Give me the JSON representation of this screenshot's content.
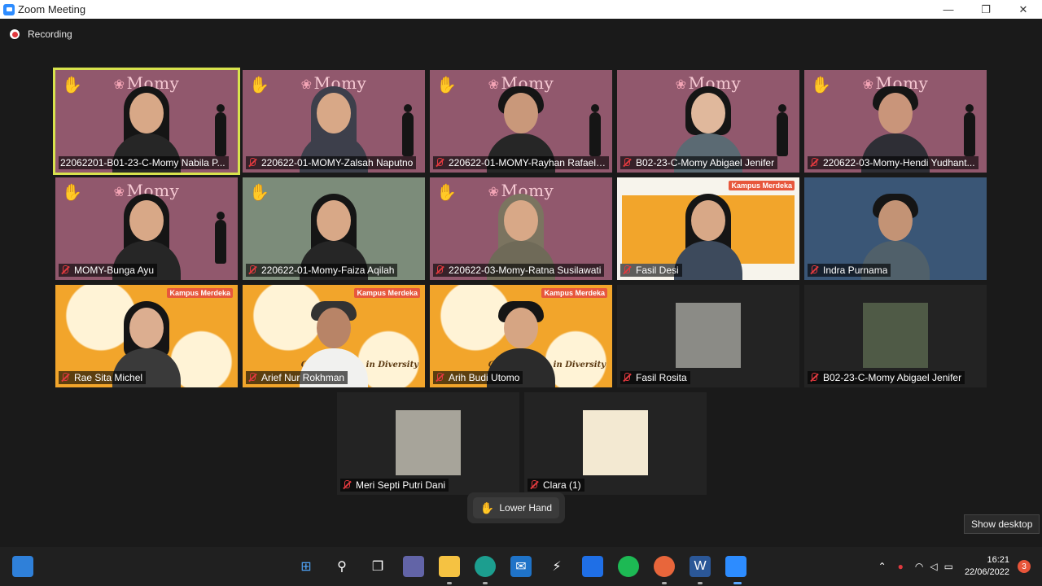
{
  "window": {
    "title": "Zoom Meeting",
    "minimize_glyph": "—",
    "restore_glyph": "❐",
    "close_glyph": "✕"
  },
  "recording": {
    "label": "Recording"
  },
  "participants": [
    {
      "name": "22062201-B01-23-C-Momy Nabila P...",
      "active": true,
      "background": "momy",
      "hand_raised": true,
      "muted": false
    },
    {
      "name": "220622-01-MOMY-Zalsah Naputno",
      "background": "momy",
      "hand_raised": true,
      "muted": true
    },
    {
      "name": "220622-01-MOMY-Rayhan Rafael ...",
      "background": "momy",
      "hand_raised": true,
      "muted": true
    },
    {
      "name": "B02-23-C-Momy Abigael Jenifer",
      "background": "momy",
      "hand_raised": false,
      "muted": true
    },
    {
      "name": "220622-03-Momy-Hendi Yudhant...",
      "background": "momy",
      "hand_raised": true,
      "muted": true
    },
    {
      "name": "MOMY-Bunga Ayu",
      "background": "momy",
      "hand_raised": true,
      "muted": true
    },
    {
      "name": "220622-01-Momy-Faiza Aqilah",
      "background": "plain",
      "hand_raised": true,
      "muted": true
    },
    {
      "name": "220622-03-Momy-Ratna Susilawati",
      "background": "momy",
      "hand_raised": true,
      "muted": true
    },
    {
      "name": "Fasil Desi",
      "background": "screen",
      "hand_raised": false,
      "muted": true
    },
    {
      "name": "Indra Purnama",
      "background": "room",
      "hand_raised": false,
      "muted": true
    },
    {
      "name": "Rae Sita Michel",
      "background": "collab",
      "hand_raised": false,
      "muted": true
    },
    {
      "name": "Arief Nur Rokhman",
      "background": "collab",
      "hand_raised": false,
      "muted": true
    },
    {
      "name": "Arih Budi Utomo",
      "background": "collab",
      "hand_raised": false,
      "muted": true
    },
    {
      "name": "Fasil Rosita",
      "background": "thumb",
      "hand_raised": false,
      "muted": true
    },
    {
      "name": "B02-23-C-Momy Abigael Jenifer",
      "background": "thumb",
      "hand_raised": false,
      "muted": true
    },
    {
      "name": "Meri Septi Putri Dani",
      "background": "thumb",
      "hand_raised": false,
      "muted": true
    },
    {
      "name": "Clara (1)",
      "background": "thumb",
      "hand_raised": false,
      "muted": true
    }
  ],
  "tile_text": {
    "momy_logo": "Momy",
    "collab_caption": "Collaboration in Diversity",
    "kampus_banner": "Kampus Merdeka"
  },
  "controls": {
    "lower_hand": "Lower Hand",
    "hand_glyph": "✋"
  },
  "show_desktop": "Show desktop",
  "taskbar": {
    "icons": [
      "widgets-icon",
      "start-icon",
      "search-icon",
      "task-view-icon",
      "chat-icon",
      "file-explorer-icon",
      "edge-icon",
      "mail-icon",
      "app-icon",
      "dropbox-icon",
      "spotify-icon",
      "firefox-icon",
      "word-icon",
      "zoom-icon"
    ],
    "time": "16:21",
    "date": "22/06/2022",
    "notification_count": "3"
  },
  "colors": {
    "accent": "#2d8cff",
    "active_speaker": "#d8e34d",
    "muted": "#e0393e",
    "momy_bg": "#91586d"
  }
}
